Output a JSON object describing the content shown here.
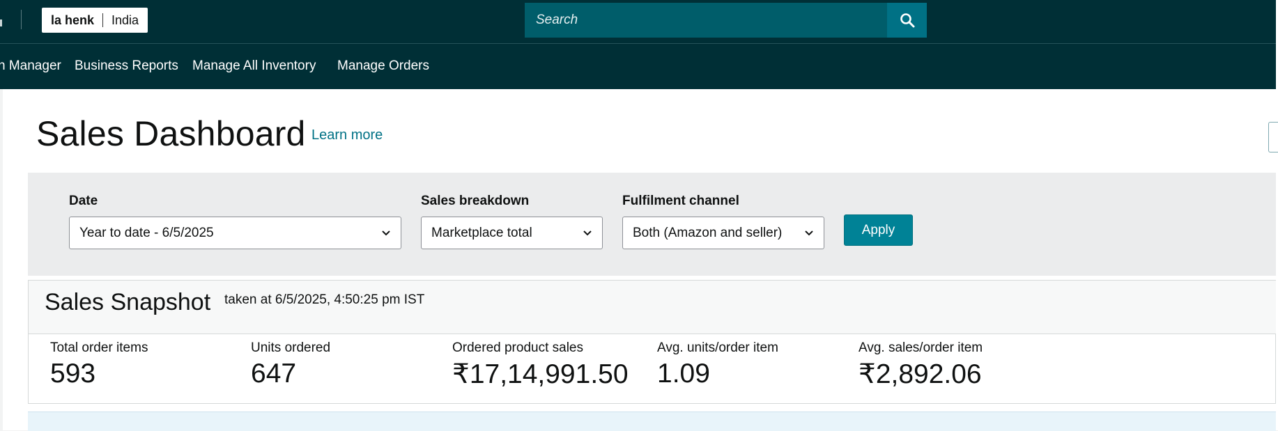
{
  "header": {
    "brand_name": "la henk",
    "brand_region": "India",
    "search_placeholder": "Search"
  },
  "nav": {
    "items": [
      "n Manager",
      "Business Reports",
      "Manage All Inventory",
      "Manage Orders"
    ]
  },
  "page": {
    "title": "Sales Dashboard",
    "learn_more": "Learn more"
  },
  "filters": {
    "date_label": "Date",
    "date_value": "Year to date - 6/5/2025",
    "breakdown_label": "Sales breakdown",
    "breakdown_value": "Marketplace total",
    "channel_label": "Fulfilment channel",
    "channel_value": "Both (Amazon and seller)",
    "apply_label": "Apply"
  },
  "snapshot": {
    "title": "Sales Snapshot",
    "taken_at": "taken at 6/5/2025, 4:50:25 pm IST",
    "metrics": [
      {
        "label": "Total order items",
        "value": "593"
      },
      {
        "label": "Units ordered",
        "value": "647"
      },
      {
        "label": "Ordered product sales",
        "value": "₹17,14,991.50"
      },
      {
        "label": "Avg. units/order item",
        "value": "1.09"
      },
      {
        "label": "Avg. sales/order item",
        "value": "₹2,892.06"
      }
    ]
  },
  "colors": {
    "header_bg": "#002f36",
    "search_bg": "#005d6a",
    "search_button": "#007185",
    "accent_link": "#007185",
    "apply_button": "#008296",
    "filter_panel_bg": "#ebeced"
  },
  "icons": [
    "search-icon",
    "chevron-down-icon"
  ]
}
